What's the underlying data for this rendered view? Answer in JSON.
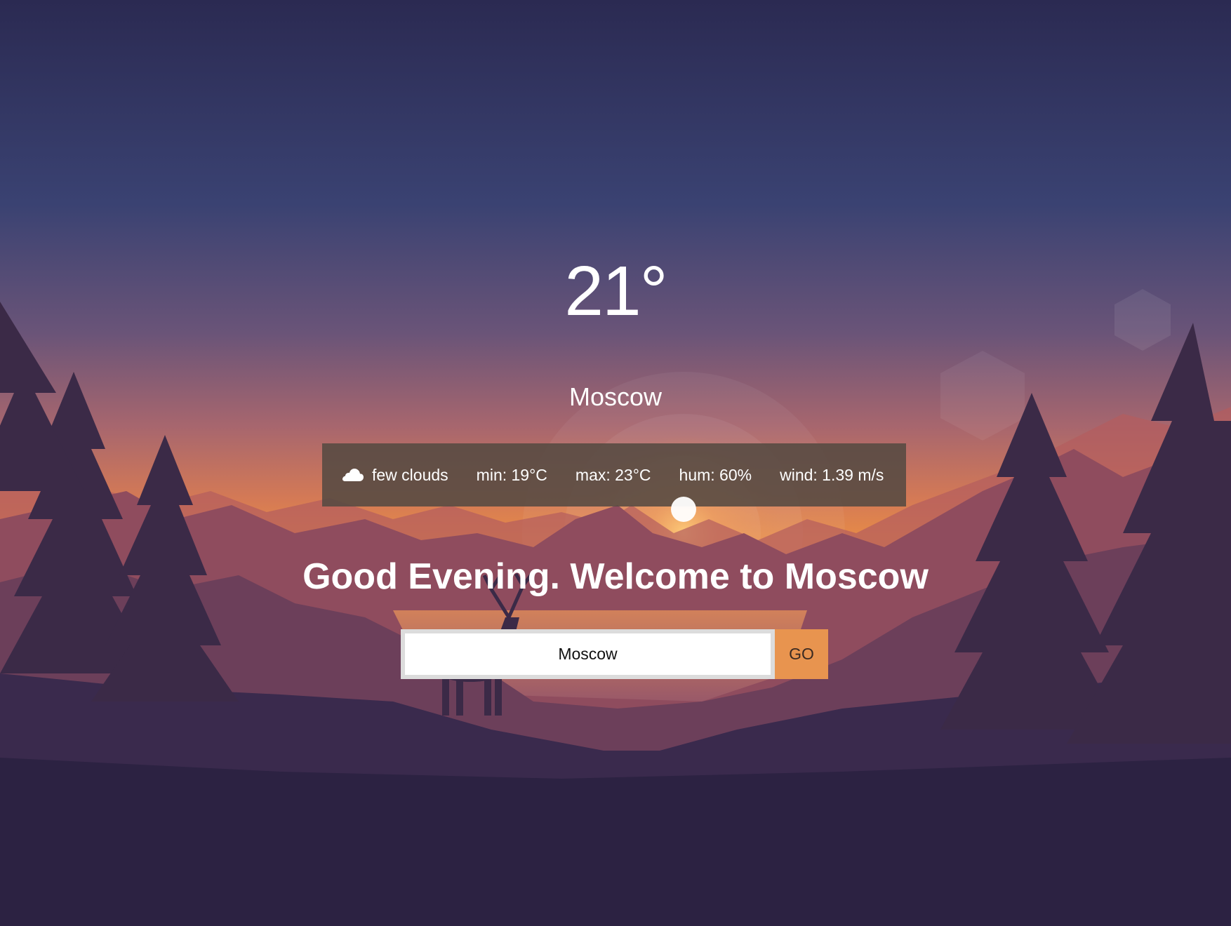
{
  "weather": {
    "temperature": "21°",
    "city": "Moscow",
    "condition_icon": "cloud-icon",
    "condition": "few clouds",
    "min": "min: 19°C",
    "max": "max: 23°C",
    "humidity": "hum: 60%",
    "wind": "wind: 1.39 m/s"
  },
  "greeting": "Good Evening. Welcome to Moscow",
  "search": {
    "value": "Moscow",
    "button_label": "GO"
  },
  "colors": {
    "sky_top": "#2b2a52",
    "sky_mid": "#3b4271",
    "horizon": "#e58a4c",
    "ground": "#2c2242",
    "stats_panel": "#554a42",
    "go_button": "#e8944f"
  }
}
